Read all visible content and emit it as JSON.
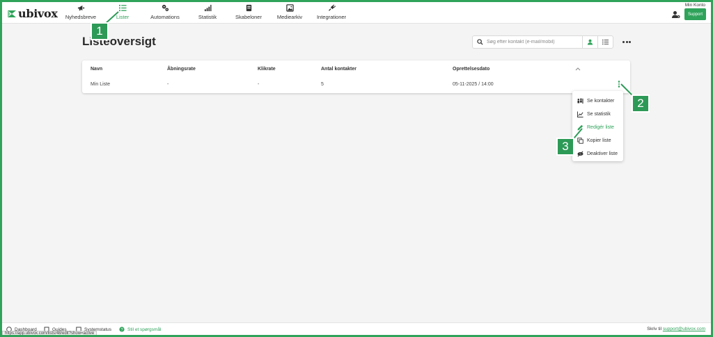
{
  "app": {
    "logo_text": "ubivox",
    "account_label": "Min Konto",
    "support_label": "Support"
  },
  "nav": [
    {
      "label": "Nyhedsbreve",
      "icon": "megaphone-icon"
    },
    {
      "label": "Lister",
      "icon": "list-icon",
      "active": true
    },
    {
      "label": "Automations",
      "icon": "cogs-icon"
    },
    {
      "label": "Statistik",
      "icon": "bar-chart-icon"
    },
    {
      "label": "Skabeloner",
      "icon": "template-icon"
    },
    {
      "label": "Mediearkiv",
      "icon": "image-icon"
    },
    {
      "label": "Integrationer",
      "icon": "plug-icon"
    }
  ],
  "page": {
    "title": "Listeoversigt",
    "search_placeholder": "Søg efter kontakt (e-mail/mobil)"
  },
  "table": {
    "columns": [
      "Navn",
      "Åbningsrate",
      "Klikrate",
      "Antal kontakter",
      "Oprettelsesdato"
    ],
    "rows": [
      [
        "Min Liste",
        "-",
        "-",
        "5",
        "05-11-2025 / 14:00"
      ]
    ]
  },
  "row_menu": [
    {
      "label": "Se kontakter",
      "icon": "contacts-icon"
    },
    {
      "label": "Se statistik",
      "icon": "line-chart-icon"
    },
    {
      "label": "Redigér liste",
      "icon": "pencil-icon",
      "highlighted": true
    },
    {
      "label": "Kopier liste",
      "icon": "copy-icon"
    },
    {
      "label": "Deaktiver liste",
      "icon": "eye-slash-icon"
    }
  ],
  "callouts": [
    "1",
    "2",
    "3"
  ],
  "footer": {
    "links": [
      "Dashboard",
      "Guides",
      "Systemstatus",
      "Stil et spørgsmål"
    ],
    "right_prefix": "Skriv til",
    "right_email": "support@ubivox.com"
  },
  "status_url": "https://app.ubivox.com/lists/48/edit?show=active",
  "colors": {
    "accent": "#2fa35a",
    "callout": "#2d9a57",
    "frame": "#2fa35a"
  }
}
